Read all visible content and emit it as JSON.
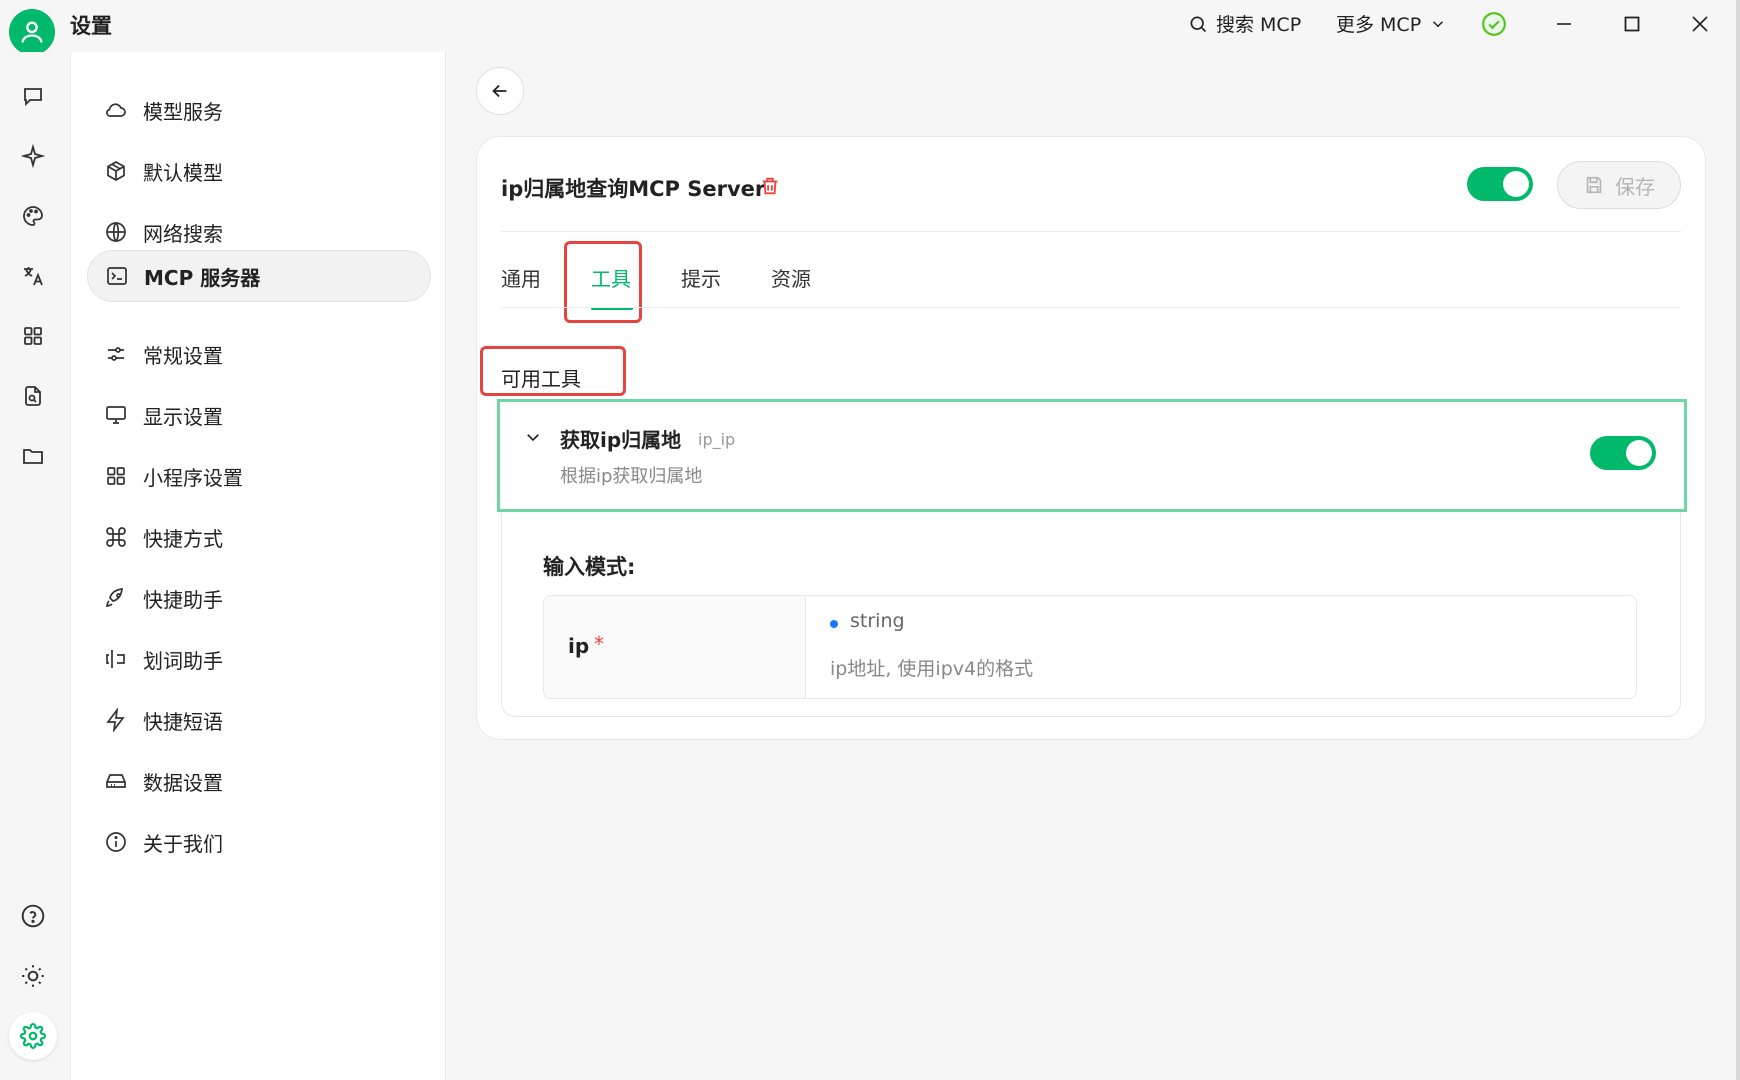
{
  "window": {
    "title": "设置",
    "search_mcp_label": "搜索 MCP",
    "more_mcp_label": "更多 MCP"
  },
  "menu": {
    "items": [
      {
        "label": "模型服务",
        "icon": "cloud-icon"
      },
      {
        "label": "默认模型",
        "icon": "cube-icon"
      },
      {
        "label": "网络搜索",
        "icon": "globe-icon"
      },
      {
        "label": "MCP 服务器",
        "icon": "terminal-icon",
        "active": true
      },
      {
        "label": "常规设置",
        "icon": "sliders-icon"
      },
      {
        "label": "显示设置",
        "icon": "monitor-icon"
      },
      {
        "label": "小程序设置",
        "icon": "grid-icon"
      },
      {
        "label": "快捷方式",
        "icon": "command-icon"
      },
      {
        "label": "快捷助手",
        "icon": "rocket-icon"
      },
      {
        "label": "划词助手",
        "icon": "text-cursor-icon"
      },
      {
        "label": "快捷短语",
        "icon": "zap-icon"
      },
      {
        "label": "数据设置",
        "icon": "hard-drive-icon"
      },
      {
        "label": "关于我们",
        "icon": "info-icon"
      }
    ]
  },
  "server": {
    "title": "ip归属地查询MCP Server",
    "enabled": true,
    "save_label": "保存"
  },
  "tabs": [
    {
      "label": "通用"
    },
    {
      "label": "工具",
      "active": true
    },
    {
      "label": "提示"
    },
    {
      "label": "资源"
    }
  ],
  "tools_section": {
    "label": "可用工具",
    "tool": {
      "name": "获取ip归属地",
      "id": "ip_ip",
      "description": "根据ip获取归属地",
      "enabled": true
    },
    "schema": {
      "title": "输入模式:",
      "param_name": "ip",
      "required_mark": "*",
      "param_type": "string",
      "param_desc": "ip地址, 使用ipv4的格式"
    }
  },
  "colors": {
    "accent": "#00b96b",
    "highlight_red": "#e5443f",
    "highlight_green": "#6dd6a2"
  }
}
